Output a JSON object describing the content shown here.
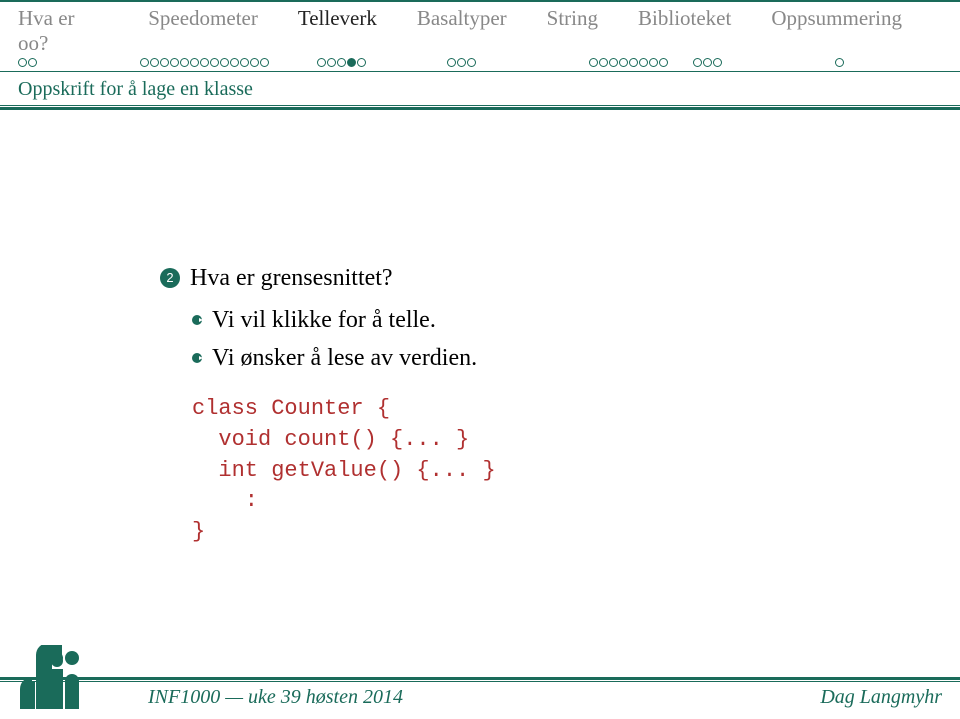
{
  "nav": {
    "items": [
      {
        "label": "Hva er oo?",
        "dots": 2,
        "active": false
      },
      {
        "label": "Speedometer",
        "dots": 13,
        "active": false
      },
      {
        "label": "Telleverk",
        "dots": 5,
        "active": true,
        "current": 3
      },
      {
        "label": "Basaltyper",
        "dots": 3,
        "active": false
      },
      {
        "label": "String",
        "dots": 8,
        "active": false
      },
      {
        "label": "Biblioteket",
        "dots": 3,
        "active": false
      },
      {
        "label": "Oppsummering",
        "dots": 1,
        "active": false
      }
    ]
  },
  "subtitle": "Oppskrift for å lage en klasse",
  "content": {
    "num": "2",
    "heading": "Hva er grensesnittet?",
    "bullets": [
      "Vi vil klikke for å telle.",
      "Vi ønsker å lese av verdien."
    ],
    "code": "class Counter {\n  void count() {... }\n  int getValue() {... }\n    :\n}"
  },
  "footer": {
    "left": "INF1000 — uke 39 høsten 2014",
    "right": "Dag Langmyhr"
  }
}
